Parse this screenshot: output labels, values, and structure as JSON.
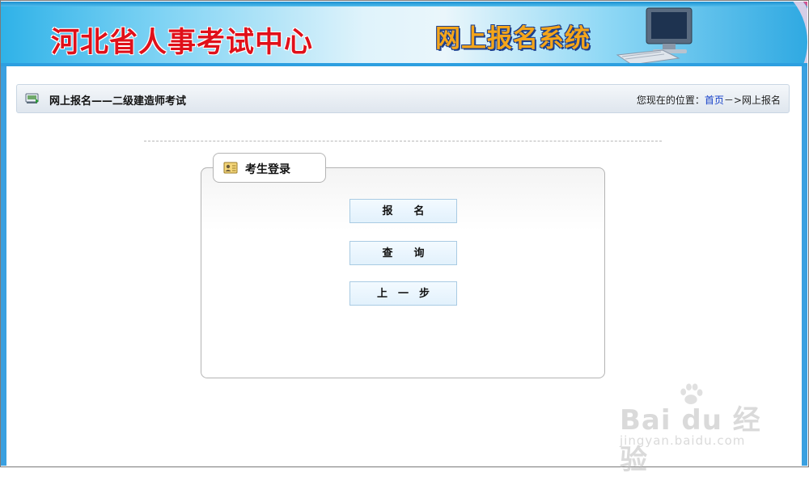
{
  "header": {
    "site_title": "河北省人事考试中心",
    "system_title": "网上报名系统"
  },
  "breadcrumb_bar": {
    "icon": "monitor-icon",
    "title": "网上报名——二级建造师考试",
    "location_prefix": "您现在的位置：",
    "home_link": "首页",
    "separator": "－>",
    "current": "网上报名"
  },
  "login_panel": {
    "tab_icon": "id-card-icon",
    "title": "考生登录",
    "buttons": {
      "register": "报　　名",
      "query": "查　　询",
      "back": "上　一　步"
    }
  },
  "watermark": {
    "text": "Bai du 经验",
    "url": "jingyan.baidu.com"
  },
  "colors": {
    "site_title_red": "#e0101a",
    "system_title_orange": "#f5a51a",
    "link_blue": "#1640c8",
    "button_border": "#a9cbe3"
  }
}
